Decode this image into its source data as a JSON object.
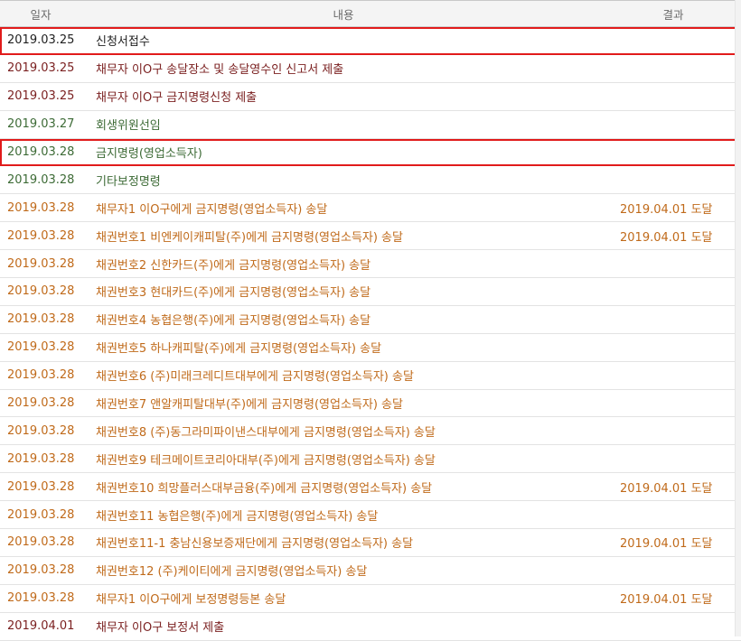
{
  "header": {
    "date": "일자",
    "content": "내용",
    "result": "결과"
  },
  "colors": {
    "black": "#1f1f1f",
    "maroon": "#7a1f1f",
    "green": "#3d6b36",
    "orange": "#c06a1a",
    "highlight_border": "#e11b1b"
  },
  "rows": [
    {
      "date": "2019.03.25",
      "content": "신청서접수",
      "result": "",
      "color": "#1f1f1f",
      "highlight": true
    },
    {
      "date": "2019.03.25",
      "content": "채무자 이O구 송달장소 및 송달영수인 신고서 제출",
      "result": "",
      "color": "#7a1f1f",
      "highlight": false
    },
    {
      "date": "2019.03.25",
      "content": "채무자 이O구 금지명령신청 제출",
      "result": "",
      "color": "#7a1f1f",
      "highlight": false
    },
    {
      "date": "2019.03.27",
      "content": "회생위원선임",
      "result": "",
      "color": "#3d6b36",
      "highlight": false
    },
    {
      "date": "2019.03.28",
      "content": "금지명령(영업소득자)",
      "result": "",
      "color": "#3d6b36",
      "highlight": true
    },
    {
      "date": "2019.03.28",
      "content": "기타보정명령",
      "result": "",
      "color": "#3d6b36",
      "highlight": false
    },
    {
      "date": "2019.03.28",
      "content": "채무자1 이O구에게 금지명령(영업소득자) 송달",
      "result": "2019.04.01 도달",
      "color": "#c06a1a",
      "highlight": false
    },
    {
      "date": "2019.03.28",
      "content": "채권번호1 비엔케이캐피탈(주)에게 금지명령(영업소득자) 송달",
      "result": "2019.04.01 도달",
      "color": "#c06a1a",
      "highlight": false
    },
    {
      "date": "2019.03.28",
      "content": "채권번호2 신한카드(주)에게 금지명령(영업소득자) 송달",
      "result": "",
      "color": "#c06a1a",
      "highlight": false
    },
    {
      "date": "2019.03.28",
      "content": "채권번호3 현대카드(주)에게 금지명령(영업소득자) 송달",
      "result": "",
      "color": "#c06a1a",
      "highlight": false
    },
    {
      "date": "2019.03.28",
      "content": "채권번호4 농협은행(주)에게 금지명령(영업소득자) 송달",
      "result": "",
      "color": "#c06a1a",
      "highlight": false
    },
    {
      "date": "2019.03.28",
      "content": "채권번호5 하나캐피탈(주)에게 금지명령(영업소득자) 송달",
      "result": "",
      "color": "#c06a1a",
      "highlight": false
    },
    {
      "date": "2019.03.28",
      "content": "채권번호6 (주)미래크레디트대부에게 금지명령(영업소득자) 송달",
      "result": "",
      "color": "#c06a1a",
      "highlight": false
    },
    {
      "date": "2019.03.28",
      "content": "채권번호7 앤알캐피탈대부(주)에게 금지명령(영업소득자) 송달",
      "result": "",
      "color": "#c06a1a",
      "highlight": false
    },
    {
      "date": "2019.03.28",
      "content": "채권번호8 (주)동그라미파이낸스대부에게 금지명령(영업소득자) 송달",
      "result": "",
      "color": "#c06a1a",
      "highlight": false
    },
    {
      "date": "2019.03.28",
      "content": "채권번호9 테크메이트코리아대부(주)에게 금지명령(영업소득자) 송달",
      "result": "",
      "color": "#c06a1a",
      "highlight": false
    },
    {
      "date": "2019.03.28",
      "content": "채권번호10 희망플러스대부금융(주)에게 금지명령(영업소득자) 송달",
      "result": "2019.04.01 도달",
      "color": "#c06a1a",
      "highlight": false
    },
    {
      "date": "2019.03.28",
      "content": "채권번호11 농협은행(주)에게 금지명령(영업소득자) 송달",
      "result": "",
      "color": "#c06a1a",
      "highlight": false
    },
    {
      "date": "2019.03.28",
      "content": "채권번호11-1 충남신용보증재단에게 금지명령(영업소득자) 송달",
      "result": "2019.04.01 도달",
      "color": "#c06a1a",
      "highlight": false
    },
    {
      "date": "2019.03.28",
      "content": "채권번호12 (주)케이티에게 금지명령(영업소득자) 송달",
      "result": "",
      "color": "#c06a1a",
      "highlight": false
    },
    {
      "date": "2019.03.28",
      "content": "채무자1 이O구에게 보정명령등본 송달",
      "result": "2019.04.01 도달",
      "color": "#c06a1a",
      "highlight": false
    },
    {
      "date": "2019.04.01",
      "content": "채무자 이O구 보정서 제출",
      "result": "",
      "color": "#7a1f1f",
      "highlight": false
    }
  ]
}
